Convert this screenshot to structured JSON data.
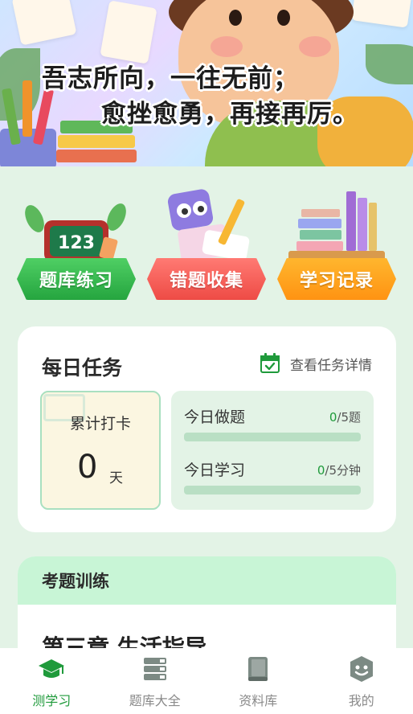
{
  "banner": {
    "motto_line1": "吾志所向，一往无前；",
    "motto_line2": "愈挫愈勇，再接再厉。"
  },
  "quick_entries": [
    {
      "label": "题库练习",
      "icon": "blackboard-123-icon",
      "color": "#2fb24a"
    },
    {
      "label": "错题收集",
      "icon": "notebook-pencil-icon",
      "color": "#f25a52"
    },
    {
      "label": "学习记录",
      "icon": "books-stack-icon",
      "color": "#ffa01e"
    }
  ],
  "daily_task": {
    "title": "每日任务",
    "detail_link": "查看任务详情",
    "detail_icon": "calendar-check-icon",
    "checkin": {
      "title": "累计打卡",
      "count": "0",
      "unit": "天"
    },
    "questions": {
      "label": "今日做题",
      "current": "0",
      "target": "/5题",
      "progress": 0
    },
    "study": {
      "label": "今日学习",
      "current": "0",
      "target": "/5分钟",
      "progress": 0
    }
  },
  "exam_training": {
    "title": "考题训练",
    "chapter": "第三章 生活指导"
  },
  "tabbar": {
    "items": [
      {
        "label": "测学习",
        "icon": "graduation-cap-icon",
        "active": true
      },
      {
        "label": "题库大全",
        "icon": "book-stack-icon",
        "active": false
      },
      {
        "label": "资料库",
        "icon": "book-icon",
        "active": false
      },
      {
        "label": "我的",
        "icon": "smiley-profile-icon",
        "active": false
      }
    ]
  },
  "colors": {
    "accent": "#1f9a3b",
    "page_bg": "#e3f3e6",
    "inactive_tab": "#8a8a8a"
  }
}
